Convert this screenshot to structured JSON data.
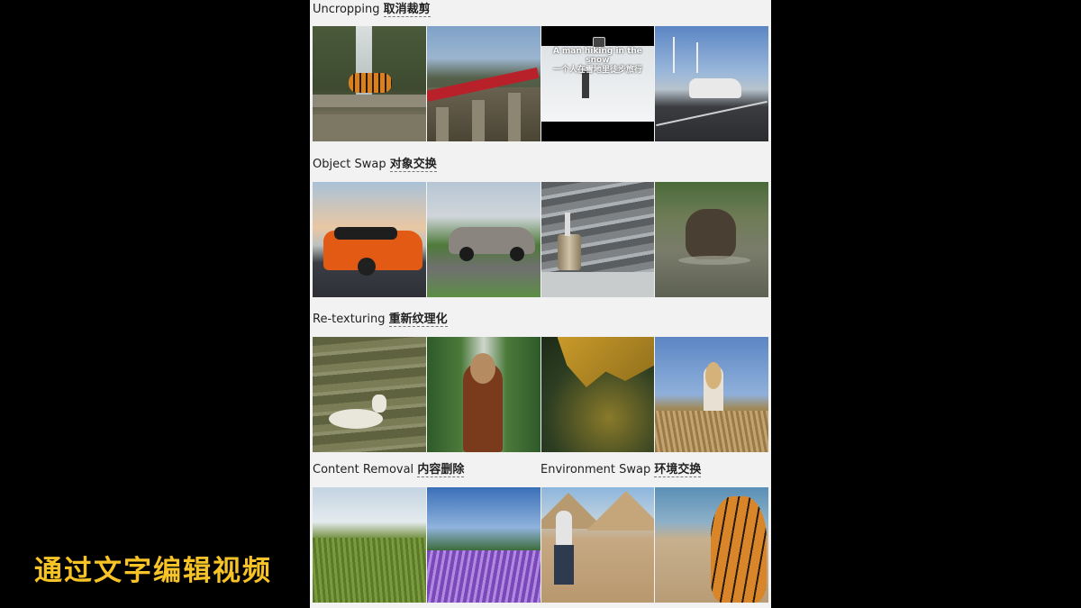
{
  "sections": {
    "uncropping": {
      "en": "Uncropping",
      "zh": "取消裁剪"
    },
    "object_swap": {
      "en": "Object Swap",
      "zh": "对象交换"
    },
    "retexturing": {
      "en": "Re-texturing",
      "zh": "重新纹理化"
    },
    "content_removal": {
      "en": "Content Removal",
      "zh": "内容删除"
    },
    "environment_swap": {
      "en": "Environment Swap",
      "zh": "环境交换"
    }
  },
  "overlay": {
    "en": "A man hiking in the snow",
    "zh": "一个人在雪地里徒步旅行"
  },
  "subtitle": "通过文字编辑视频",
  "colors": {
    "subtitle": "#f7c326",
    "panel_bg": "#f2f2f2",
    "page_bg": "#000000"
  }
}
